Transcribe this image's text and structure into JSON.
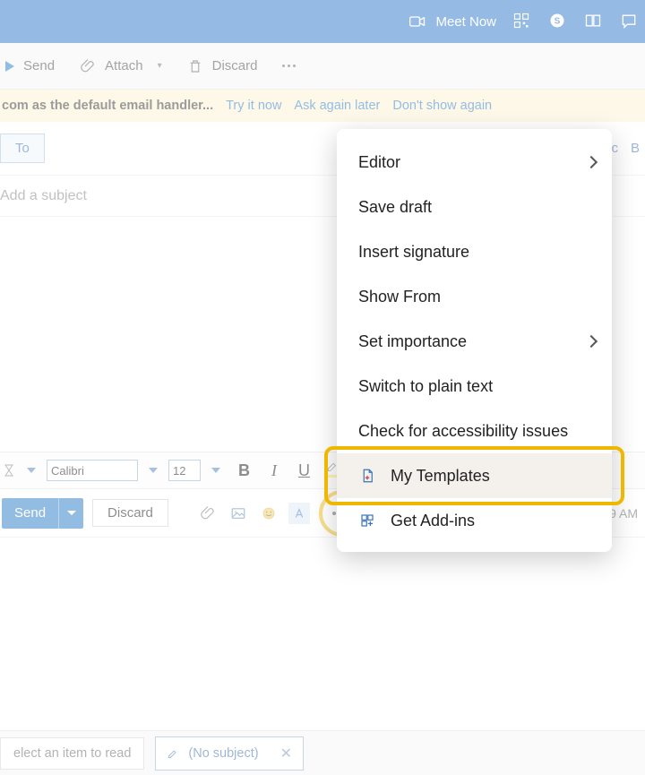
{
  "topbar": {
    "meet_now": "Meet Now"
  },
  "toolbar": {
    "send": "Send",
    "attach": "Attach",
    "discard": "Discard"
  },
  "notice": {
    "prefix": "com as the default email handler...",
    "try": "Try it now",
    "later": "Ask again later",
    "dont": "Don't show again"
  },
  "to": {
    "label": "To",
    "cc": "Cc",
    "bcc": "B"
  },
  "subject": {
    "placeholder": "Add a subject"
  },
  "format": {
    "font_name": "Calibri",
    "font_size": "12"
  },
  "compose2": {
    "send": "Send",
    "discard": "Discard",
    "draft_status": "Draft saved at 10:49 AM"
  },
  "popup": {
    "editor": "Editor",
    "save_draft": "Save draft",
    "insert_signature": "Insert signature",
    "show_from": "Show From",
    "set_importance": "Set importance",
    "plain_text": "Switch to plain text",
    "accessibility": "Check for accessibility issues",
    "my_templates": "My Templates",
    "get_addins": "Get Add-ins"
  },
  "bottom": {
    "read_tab": "elect an item to read",
    "subject_tab": "(No subject)"
  }
}
